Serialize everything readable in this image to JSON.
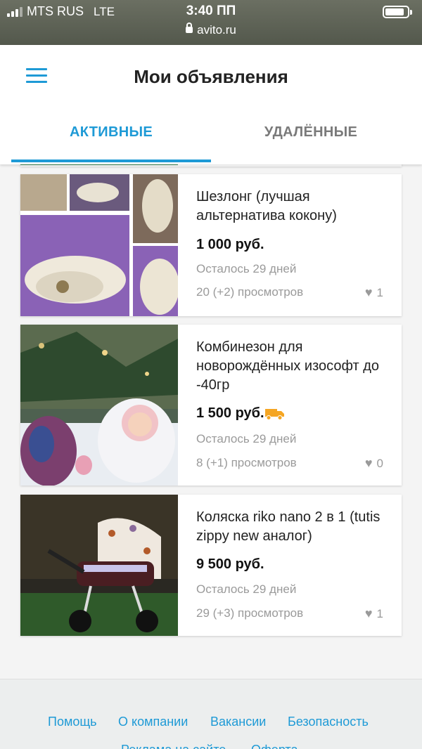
{
  "status_bar": {
    "carrier": "MTS RUS",
    "network": "LTE",
    "time": "3:40 ПП",
    "url": "avito.ru"
  },
  "header": {
    "menu_icon": "hamburger-menu-icon",
    "title": "Мои объявления"
  },
  "tabs": [
    {
      "label": "АКТИВНЫЕ",
      "active": true
    },
    {
      "label": "УДАЛЁННЫЕ",
      "active": false
    }
  ],
  "listings": [
    {
      "title": "Шезлонг (лучшая альтернатива кокону)",
      "price": "1 000 руб.",
      "delivery": false,
      "remaining": "Осталось 29 дней",
      "views": "20 (+2) просмотров",
      "favorites": "1"
    },
    {
      "title": "Комбинезон для новорождённых изософт до -40гр",
      "price": "1 500 руб.",
      "delivery": true,
      "remaining": "Осталось 29 дней",
      "views": "8 (+1) просмотров",
      "favorites": "0"
    },
    {
      "title": "Коляска riko nano 2 в 1 (tutis zippy new аналог)",
      "price": "9 500 руб.",
      "delivery": false,
      "remaining": "Осталось 29 дней",
      "views": "29 (+3) просмотров",
      "favorites": "1"
    }
  ],
  "footer": {
    "links": [
      "Помощь",
      "О компании",
      "Вакансии",
      "Безопасность",
      "Реклама на сайте",
      "Оферта"
    ]
  },
  "colors": {
    "accent": "#1e9ad6",
    "muted_text": "#9a9a9a",
    "delivery_icon": "#f5a623"
  }
}
